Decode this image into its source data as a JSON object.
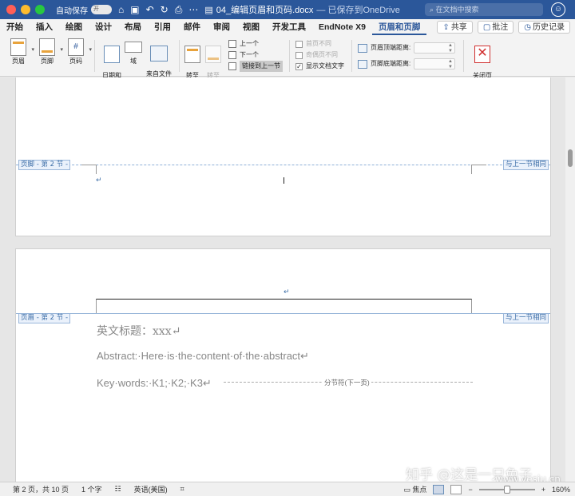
{
  "titlebar": {
    "autosave_label": "自动保存",
    "autosave_state": "开",
    "doc_name": "04_编辑页眉和页码.docx",
    "saved_status": "— 已保存到OneDrive",
    "search_placeholder": "在文档中搜索"
  },
  "tabs": [
    "开始",
    "插入",
    "绘图",
    "设计",
    "布局",
    "引用",
    "邮件",
    "审阅",
    "视图",
    "开发工具",
    "EndNote X9",
    "页眉和页脚"
  ],
  "active_tab": "页眉和页脚",
  "tab_actions": {
    "share": "共享",
    "comment": "批注",
    "history": "历史记录"
  },
  "ribbon": {
    "header": "页眉",
    "footer": "页脚",
    "page_number": "页码",
    "date_time": "日期和\n时间",
    "field": "域",
    "picture_from_file": "来自文件\n的图片",
    "goto_header": "转至\n页眉",
    "goto_footer": "转至\n页脚",
    "prev": "上一个",
    "next": "下一个",
    "link_to_previous": "链接到上一节",
    "different_first": "首页不同",
    "different_odd_even": "奇偶页不同",
    "show_doc_text": "显示文档文字",
    "header_top_distance": "页眉顶端距离:",
    "footer_bottom_distance": "页脚底端距离:",
    "close": "关闭页\n眉和页脚"
  },
  "page1": {
    "footer_label": "页脚 - 第 2 节 -",
    "same_as_previous": "与上一节相同",
    "para_mark": "↵"
  },
  "page2": {
    "para_mark": "↵",
    "header_label": "页眉 - 第 2 节 -",
    "same_as_previous": "与上一节相同",
    "title_line": "英文标题：xxx↵",
    "abstract_line": "Abstract:·Here·is·the·content·of·the·abstract↵",
    "keywords_line": "Key·words:·K1;·K2;·K3↵",
    "section_break": "分节符(下一页)"
  },
  "watermark": {
    "text": "知乎 @这是一只兔子",
    "url": "www.yesiu.cn"
  },
  "statusbar": {
    "page_info": "第 2 页，共 10 页",
    "word_count": "1 个字",
    "language": "英语(美国)",
    "focus": "焦点",
    "zoom": "160%",
    "zoom_level": 0.5
  }
}
